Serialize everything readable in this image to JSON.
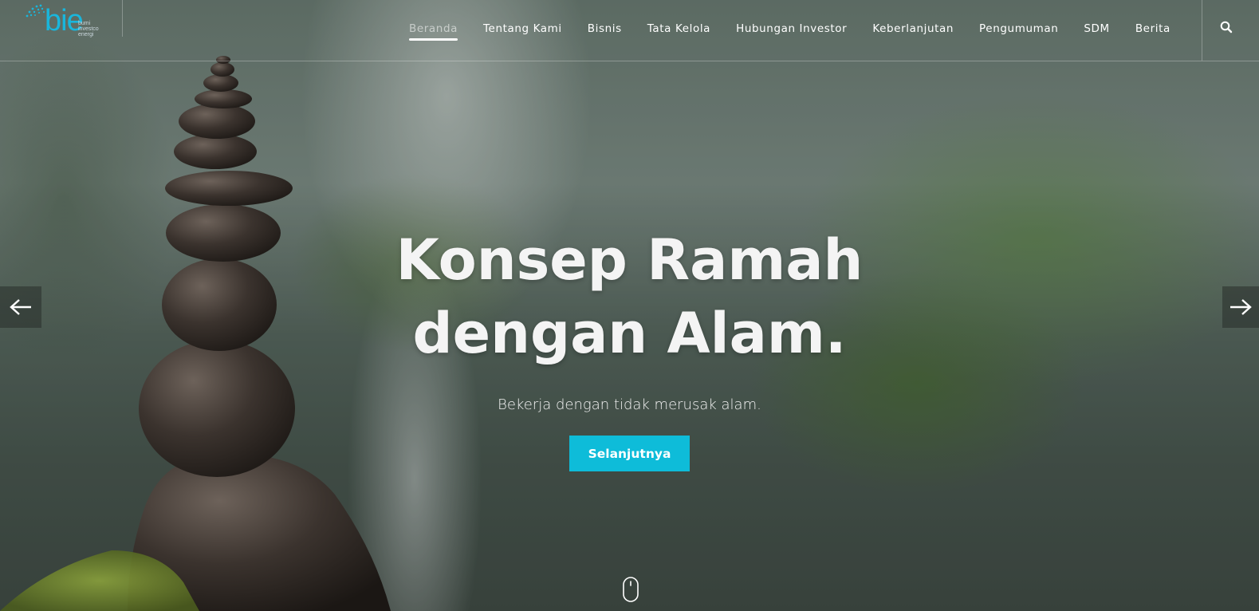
{
  "logo": {
    "name": "bie",
    "sub_lines": [
      "bumi",
      "investco",
      "energi"
    ],
    "accent_color": "#19b6dc"
  },
  "nav": {
    "items": [
      {
        "label": "Beranda",
        "active": true
      },
      {
        "label": "Tentang Kami",
        "active": false
      },
      {
        "label": "Bisnis",
        "active": false
      },
      {
        "label": "Tata Kelola",
        "active": false
      },
      {
        "label": "Hubungan Investor",
        "active": false
      },
      {
        "label": "Keberlanjutan",
        "active": false
      },
      {
        "label": "Pengumuman",
        "active": false
      },
      {
        "label": "SDM",
        "active": false
      },
      {
        "label": "Berita",
        "active": false
      }
    ],
    "search_icon": "search-icon"
  },
  "hero": {
    "title_line1": "Konsep Ramah",
    "title_line2": "dengan Alam.",
    "subtitle": "Bekerja dengan tidak merusak alam.",
    "button_label": "Selanjutnya",
    "button_color": "#0ebcd9",
    "prev_icon": "arrow-left-icon",
    "next_icon": "arrow-right-icon",
    "scroll_icon": "mouse-scroll-icon"
  }
}
